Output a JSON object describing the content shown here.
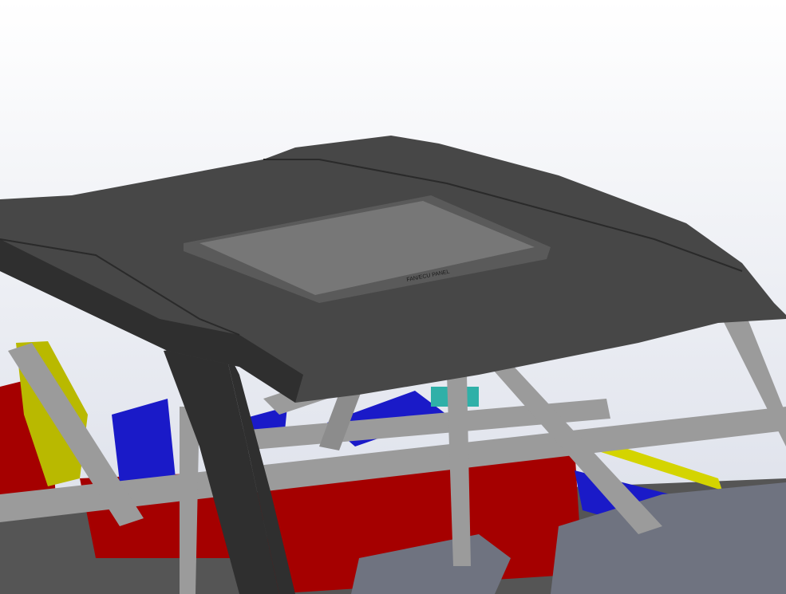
{
  "viewport": {
    "panel_label": "FAN/ECU PANEL"
  },
  "colors": {
    "background_top": "#ffffff",
    "background_bottom": "#d9dde8",
    "roof": "#474747",
    "roof_dark": "#2f2f2f",
    "panel": "#777777",
    "panel_frame": "#5a5a5a",
    "rollcage": "#9b9b9b",
    "red_panel": "#a50000",
    "blue_panel": "#1a1ac8",
    "yellow_trim": "#d4d400",
    "teal_part": "#2fb0a8",
    "floor": "#555555",
    "seat": "#6f7380"
  },
  "icons": [
    "cad-rollcage-roof-model"
  ]
}
